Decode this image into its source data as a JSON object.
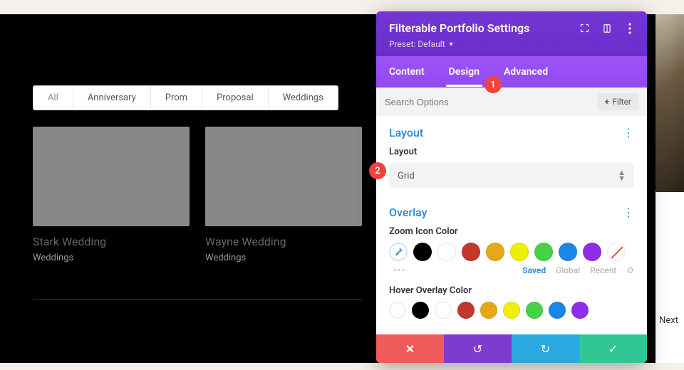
{
  "filters": {
    "items": [
      "All",
      "Anniversary",
      "Prom",
      "Proposal",
      "Weddings"
    ],
    "active": "All"
  },
  "portfolio": {
    "items": [
      {
        "title": "Stark Wedding",
        "category": "Weddings"
      },
      {
        "title": "Wayne Wedding",
        "category": "Weddings"
      }
    ]
  },
  "nav": {
    "next": "Next"
  },
  "panel": {
    "title": "Filterable Portfolio Settings",
    "preset_label": "Preset: Default",
    "tabs": {
      "content": "Content",
      "design": "Design",
      "advanced": "Advanced",
      "active": "design"
    },
    "search_placeholder": "Search Options",
    "filter_btn": "Filter",
    "sections": {
      "layout": {
        "title": "Layout",
        "field_label": "Layout",
        "value": "Grid"
      },
      "overlay": {
        "title": "Overlay",
        "zoom_label": "Zoom Icon Color",
        "hover_label": "Hover Overlay Color",
        "swatches": [
          "#000000",
          "#ffffff",
          "#c0392b",
          "#e67e22",
          "#f1eb00",
          "#2ecc40",
          "#1b87e5",
          "#8e44ec"
        ],
        "meta": {
          "saved": "Saved",
          "global": "Global",
          "recent": "Recent"
        }
      }
    }
  },
  "annotations": {
    "a1": "1",
    "a2": "2"
  }
}
